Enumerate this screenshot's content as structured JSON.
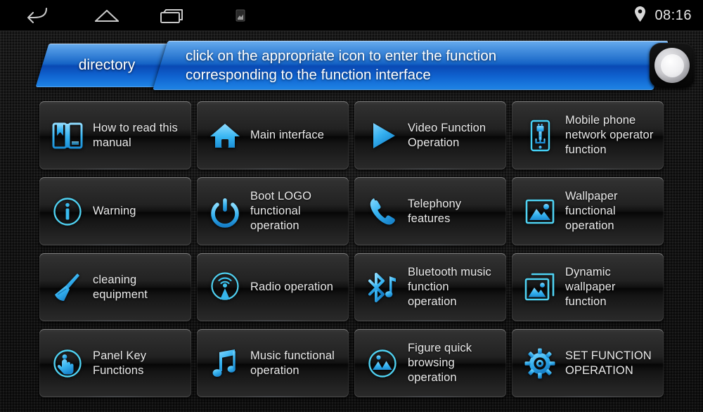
{
  "statusbar": {
    "icons": [
      {
        "name": "back-icon",
        "label": "Back"
      },
      {
        "name": "home-icon",
        "label": "Home"
      },
      {
        "name": "recents-icon",
        "label": "Recent apps"
      },
      {
        "name": "screenshot-icon",
        "label": "Screenshot"
      }
    ],
    "location_icon": "location-pin-icon",
    "clock": "08:16"
  },
  "header": {
    "tab_label": "directory",
    "hint_line1": "click on the appropriate icon to enter the function",
    "hint_line2": "corresponding to the function interface",
    "knob_label": "rotary-knob"
  },
  "colors": {
    "accent_blue": "#1f7ada",
    "icon_cyan": "#4fc3f7",
    "tile_dark": "#1a1a1a",
    "text": "#eaeaea"
  },
  "grid": {
    "tiles": [
      {
        "icon": "book-icon",
        "label": "How to read this manual"
      },
      {
        "icon": "home-house-icon",
        "label": "Main interface"
      },
      {
        "icon": "play-triangle-icon",
        "label": "Video Function Operation"
      },
      {
        "icon": "phone-usb-icon",
        "label": "Mobile phone network operator function"
      },
      {
        "icon": "info-circle-icon",
        "label": "Warning"
      },
      {
        "icon": "power-icon",
        "label": "Boot LOGO functional operation"
      },
      {
        "icon": "phone-handset-icon",
        "label": "Telephony features"
      },
      {
        "icon": "picture-frame-icon",
        "label": "Wallpaper functional operation"
      },
      {
        "icon": "broom-icon",
        "label": "cleaning equipment"
      },
      {
        "icon": "radio-tower-icon",
        "label": "Radio operation"
      },
      {
        "icon": "bluetooth-music-icon",
        "label": "Bluetooth music function operation"
      },
      {
        "icon": "stacked-pictures-icon",
        "label": "Dynamic wallpaper function"
      },
      {
        "icon": "touch-hand-icon",
        "label": "Panel Key Functions"
      },
      {
        "icon": "music-note-icon",
        "label": "Music functional operation"
      },
      {
        "icon": "gallery-circle-icon",
        "label": "Figure quick browsing operation"
      },
      {
        "icon": "gear-icon",
        "label": "SET FUNCTION OPERATION"
      }
    ]
  }
}
